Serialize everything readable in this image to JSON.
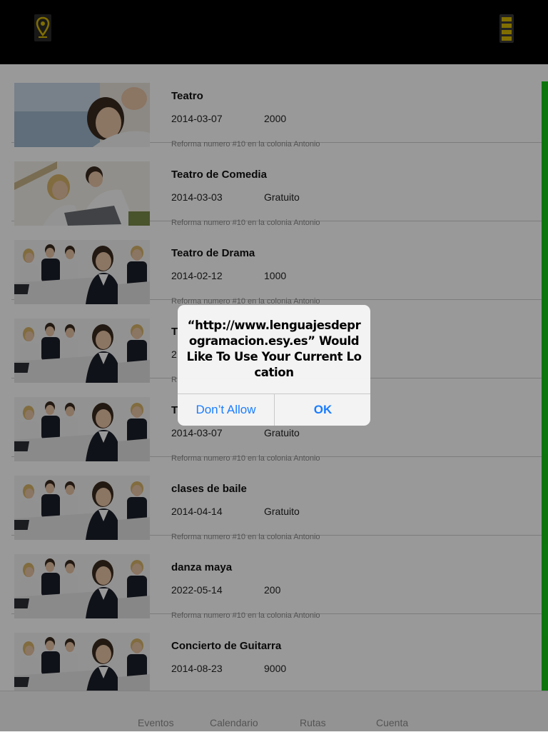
{
  "header": {
    "location_icon": "map-pin-icon",
    "menu_icon": "hamburger-menu-icon"
  },
  "events": [
    {
      "title": "Teatro",
      "date": "2014-03-07",
      "price": "2000",
      "address": "Reforma numero #10 en la colonia Antonio",
      "thumbnail": "couple-photo"
    },
    {
      "title": "Teatro de Comedia",
      "date": "2014-03-03",
      "price": "Gratuito",
      "address": "Reforma numero #10 en la colonia Antonio",
      "thumbnail": "couple-laptop-photo"
    },
    {
      "title": "Teatro de Drama",
      "date": "2014-02-12",
      "price": "1000",
      "address": "Reforma numero #10 en la colonia Antonio",
      "thumbnail": "business-team-photo"
    },
    {
      "title": "T",
      "date": "2",
      "price": "",
      "address": "R",
      "thumbnail": "business-team-photo"
    },
    {
      "title": "T",
      "date": "2014-03-07",
      "price": "Gratuito",
      "address": "Reforma numero #10 en la colonia Antonio",
      "thumbnail": "business-team-photo"
    },
    {
      "title": "clases de baile",
      "date": "2014-04-14",
      "price": "Gratuito",
      "address": "Reforma numero #10 en la colonia Antonio",
      "thumbnail": "business-team-photo"
    },
    {
      "title": "danza maya",
      "date": "2022-05-14",
      "price": "200",
      "address": "Reforma numero #10 en la colonia Antonio",
      "thumbnail": "business-team-photo"
    },
    {
      "title": "Concierto de Guitarra",
      "date": "2014-08-23",
      "price": "9000",
      "address": "",
      "thumbnail": "business-team-photo"
    }
  ],
  "tabs": [
    {
      "label": "Eventos"
    },
    {
      "label": "Calendario"
    },
    {
      "label": "Rutas"
    },
    {
      "label": "Cuenta"
    }
  ],
  "alert": {
    "message": "“http://www.lenguajesdeprogramacion.esy.es” Would Like To Use Your Current Location",
    "deny_label": "Don’t Allow",
    "ok_label": "OK"
  },
  "colors": {
    "accent_green": "#18c418",
    "alert_button": "#1a7dff",
    "topbar": "#000000",
    "icon_yellow": "#d6b800"
  }
}
